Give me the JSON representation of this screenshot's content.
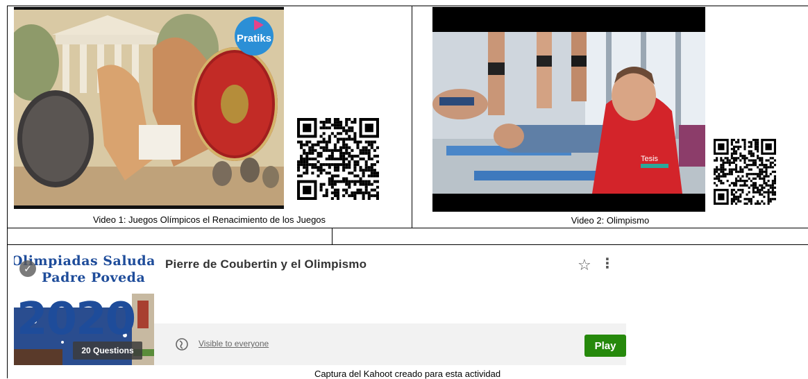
{
  "videos": [
    {
      "caption": "Video 1: Juegos Olímpicos el Renacimiento de los Juegos",
      "brand": "Pratiks"
    },
    {
      "caption": "Video 2: Olimpismo",
      "brand": "Tesis"
    }
  ],
  "kahoot": {
    "cover_line1": "Olimpiadas Saludable",
    "cover_line2": "Padre Poveda",
    "cover_year": "2020",
    "questions": "20 Questions",
    "title": "Pierre de Coubertin y el Olimpismo",
    "visibility": "Visible to everyone",
    "play_label": "Play",
    "caption": "Captura del Kahoot creado para esta actividad"
  },
  "colors": {
    "play": "#26890c",
    "cover_text": "#1e4c9a"
  },
  "icons": {
    "favorite": "star-outline-icon",
    "menu": "more-vertical-icon",
    "visibility": "globe-icon",
    "selected": "check-icon"
  }
}
